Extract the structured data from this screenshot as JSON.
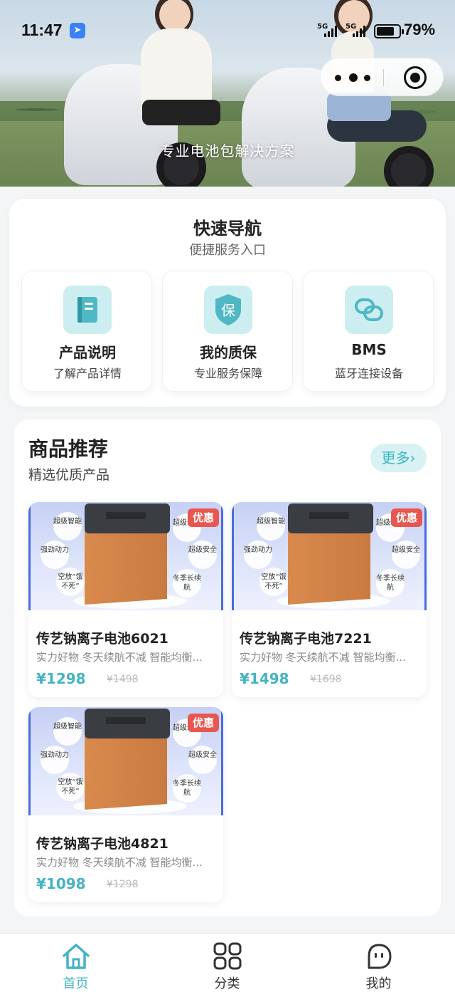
{
  "status_bar": {
    "time": "11:47",
    "network_1": "5G",
    "network_2": "5G",
    "battery": "79%"
  },
  "hero": {
    "caption": "专业电池包解决方案"
  },
  "quick_nav": {
    "title": "快速导航",
    "subtitle": "便捷服务入口",
    "items": [
      {
        "label": "产品说明",
        "desc": "了解产品详情",
        "icon": "book-icon"
      },
      {
        "label": "我的质保",
        "desc": "专业服务保障",
        "icon": "shield-icon",
        "icon_text": "保"
      },
      {
        "label": "BMS",
        "desc": "蓝牙连接设备",
        "icon": "link-icon"
      }
    ]
  },
  "recommend": {
    "title": "商品推荐",
    "subtitle": "精选优质产品",
    "more_label": "更多",
    "products": [
      {
        "name": "传艺钠离子电池6021",
        "desc": "实力好物 冬天续航不减 智能均衡...",
        "price": "¥1298",
        "orig_price": "¥1498",
        "badge": "优惠"
      },
      {
        "name": "传艺钠离子电池7221",
        "desc": "实力好物 冬天续航不减 智能均衡...",
        "price": "¥1498",
        "orig_price": "¥1698",
        "badge": "优惠"
      },
      {
        "name": "传艺钠离子电池4821",
        "desc": "实力好物 冬天续航不减 智能均衡...",
        "price": "¥1098",
        "orig_price": "¥1298",
        "badge": "优惠"
      }
    ],
    "image_features": [
      "超级智能",
      "强劲动力",
      "空放“饿不死”",
      "超级寿命",
      "超级安全",
      "冬季长续航"
    ]
  },
  "tabbar": {
    "items": [
      {
        "label": "首页",
        "icon": "home-icon",
        "active": true
      },
      {
        "label": "分类",
        "icon": "grid-icon",
        "active": false
      },
      {
        "label": "我的",
        "icon": "profile-icon",
        "active": false
      }
    ]
  },
  "colors": {
    "accent": "#44b3c2",
    "badge": "#e8574f",
    "icon_bg": "#cdeef0"
  }
}
